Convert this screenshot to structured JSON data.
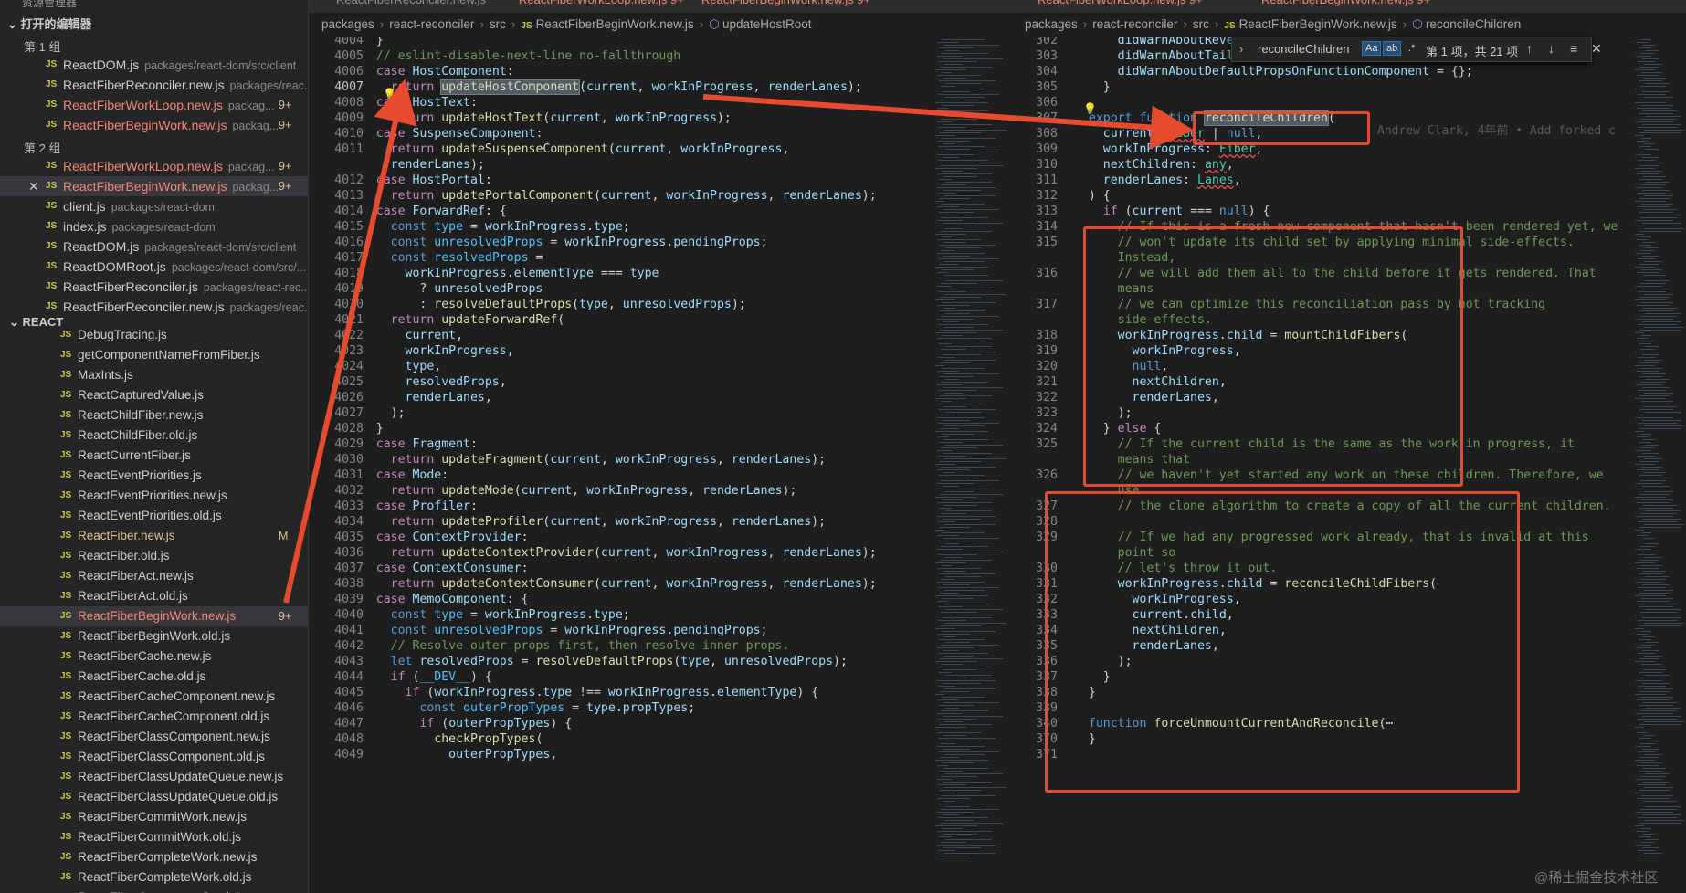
{
  "sidebar": {
    "top_label": "资源管理器",
    "open_editors_title": "打开的编辑器",
    "group1": "第 1 组",
    "group2": "第 2 组",
    "group1_items": [
      {
        "name": "ReactDOM.js",
        "path": "packages/react-dom/src/client",
        "badge": ""
      },
      {
        "name": "ReactFiberReconciler.new.js",
        "path": "packages/reac...",
        "badge": ""
      },
      {
        "name": "ReactFiberWorkLoop.new.js",
        "path": "packag...",
        "badge": "9+"
      },
      {
        "name": "ReactFiberBeginWork.new.js",
        "path": "packag...",
        "badge": "9+"
      }
    ],
    "group2_items": [
      {
        "name": "ReactFiberWorkLoop.new.js",
        "path": "packag...",
        "badge": "9+"
      },
      {
        "name": "ReactFiberBeginWork.new.js",
        "path": "packag...",
        "badge": "9+"
      },
      {
        "name": "client.js",
        "path": "packages/react-dom",
        "badge": ""
      },
      {
        "name": "index.js",
        "path": "packages/react-dom",
        "badge": ""
      },
      {
        "name": "ReactDOM.js",
        "path": "packages/react-dom/src/client",
        "badge": ""
      },
      {
        "name": "ReactDOMRoot.js",
        "path": "packages/react-dom/src/...",
        "badge": ""
      },
      {
        "name": "ReactFiberReconciler.js",
        "path": "packages/react-rec...",
        "badge": ""
      },
      {
        "name": "ReactFiberReconciler.new.js",
        "path": "packages/reac...",
        "badge": ""
      }
    ],
    "react_title": "REACT",
    "files": [
      {
        "name": "DebugTracing.js",
        "badge": ""
      },
      {
        "name": "getComponentNameFromFiber.js",
        "badge": ""
      },
      {
        "name": "MaxInts.js",
        "badge": ""
      },
      {
        "name": "ReactCapturedValue.js",
        "badge": ""
      },
      {
        "name": "ReactChildFiber.new.js",
        "badge": ""
      },
      {
        "name": "ReactChildFiber.old.js",
        "badge": ""
      },
      {
        "name": "ReactCurrentFiber.js",
        "badge": ""
      },
      {
        "name": "ReactEventPriorities.js",
        "badge": ""
      },
      {
        "name": "ReactEventPriorities.new.js",
        "badge": ""
      },
      {
        "name": "ReactEventPriorities.old.js",
        "badge": ""
      },
      {
        "name": "ReactFiber.new.js",
        "badge": "M"
      },
      {
        "name": "ReactFiber.old.js",
        "badge": ""
      },
      {
        "name": "ReactFiberAct.new.js",
        "badge": ""
      },
      {
        "name": "ReactFiberAct.old.js",
        "badge": ""
      },
      {
        "name": "ReactFiberBeginWork.new.js",
        "badge": "9+"
      },
      {
        "name": "ReactFiberBeginWork.old.js",
        "badge": ""
      },
      {
        "name": "ReactFiberCache.new.js",
        "badge": ""
      },
      {
        "name": "ReactFiberCache.old.js",
        "badge": ""
      },
      {
        "name": "ReactFiberCacheComponent.new.js",
        "badge": ""
      },
      {
        "name": "ReactFiberCacheComponent.old.js",
        "badge": ""
      },
      {
        "name": "ReactFiberClassComponent.new.js",
        "badge": ""
      },
      {
        "name": "ReactFiberClassComponent.old.js",
        "badge": ""
      },
      {
        "name": "ReactFiberClassUpdateQueue.new.js",
        "badge": ""
      },
      {
        "name": "ReactFiberClassUpdateQueue.old.js",
        "badge": ""
      },
      {
        "name": "ReactFiberCommitWork.new.js",
        "badge": ""
      },
      {
        "name": "ReactFiberCommitWork.old.js",
        "badge": ""
      },
      {
        "name": "ReactFiberCompleteWork.new.js",
        "badge": ""
      },
      {
        "name": "ReactFiberCompleteWork.old.js",
        "badge": ""
      },
      {
        "name": "ReactFiberComponentStack.js",
        "badge": ""
      }
    ]
  },
  "tabs_left": [
    "ReactFiberReconciler.new.js",
    "ReactFiberWorkLoop.new.js 9+",
    "ReactFiberBeginWork.new.js 9+"
  ],
  "tabs_right": [
    "ReactFiberWorkLoop.new.js 9+",
    "ReactFiberBeginWork.new.js 9+"
  ],
  "breadcrumb_left": [
    "packages",
    "react-reconciler",
    "src",
    "ReactFiberBeginWork.new.js",
    "updateHostRoot"
  ],
  "breadcrumb_right": [
    "packages",
    "react-reconciler",
    "src",
    "ReactFiberBeginWork.new.js",
    "reconcileChildren"
  ],
  "find_widget": {
    "value": "reconcileChildren",
    "case_label": "Aa",
    "word_label": "ab",
    "regex_label": ".*",
    "count": "第 1 项，共 21 项"
  },
  "blame": "Andrew Clark, 4年前 • Add forked c",
  "watermark": "@稀土掘金技术社区",
  "left_editor_lines": [
    "4004",
    "4005",
    "4006",
    "4007",
    "4008",
    "4009",
    "4010",
    "4011",
    "",
    "4012",
    "4013",
    "4014",
    "4015",
    "4016",
    "4017",
    "4018",
    "4019",
    "4020",
    "4021",
    "4022",
    "4023",
    "4024",
    "4025",
    "4026",
    "4027",
    "4028",
    "4029",
    "4030",
    "4031",
    "4032",
    "4033",
    "4034",
    "4035",
    "4036",
    "4037",
    "4038",
    "4039",
    "4040",
    "4041",
    "4042",
    "4043",
    "4044",
    "4045",
    "4046",
    "4047",
    "4048",
    "4049"
  ],
  "right_editor_lines": [
    "302",
    "303",
    "304",
    "305",
    "306",
    "307",
    "308",
    "309",
    "310",
    "311",
    "312",
    "313",
    "314",
    "315",
    "",
    "316",
    "",
    "317",
    "",
    "318",
    "319",
    "320",
    "321",
    "322",
    "323",
    "324",
    "325",
    "",
    "326",
    "",
    "327",
    "328",
    "329",
    "",
    "330",
    "331",
    "332",
    "333",
    "334",
    "335",
    "336",
    "337",
    "338",
    "339",
    "340",
    "370",
    "371"
  ],
  "accent_color": "#e64b2e"
}
